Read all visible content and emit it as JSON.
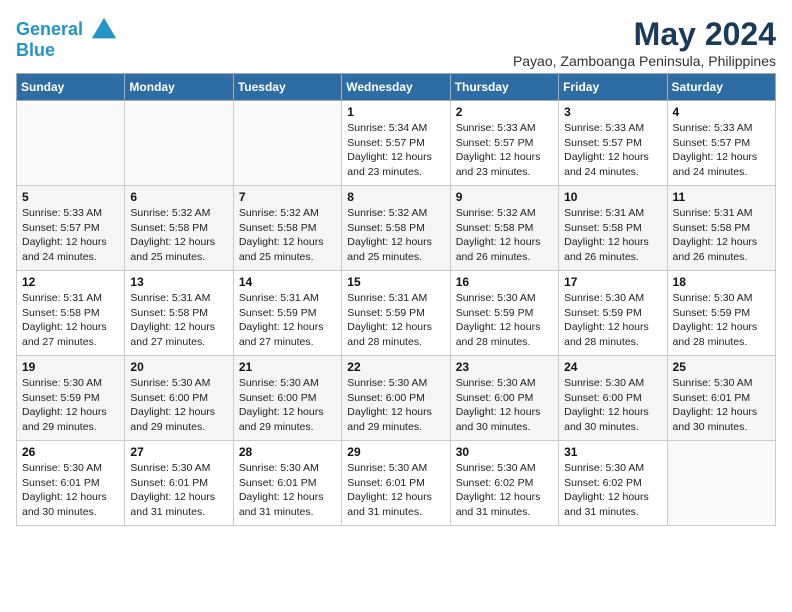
{
  "header": {
    "logo_line1": "General",
    "logo_line2": "Blue",
    "month": "May 2024",
    "location": "Payao, Zamboanga Peninsula, Philippines"
  },
  "weekdays": [
    "Sunday",
    "Monday",
    "Tuesday",
    "Wednesday",
    "Thursday",
    "Friday",
    "Saturday"
  ],
  "weeks": [
    [
      {
        "day": "",
        "info": ""
      },
      {
        "day": "",
        "info": ""
      },
      {
        "day": "",
        "info": ""
      },
      {
        "day": "1",
        "info": "Sunrise: 5:34 AM\nSunset: 5:57 PM\nDaylight: 12 hours\nand 23 minutes."
      },
      {
        "day": "2",
        "info": "Sunrise: 5:33 AM\nSunset: 5:57 PM\nDaylight: 12 hours\nand 23 minutes."
      },
      {
        "day": "3",
        "info": "Sunrise: 5:33 AM\nSunset: 5:57 PM\nDaylight: 12 hours\nand 24 minutes."
      },
      {
        "day": "4",
        "info": "Sunrise: 5:33 AM\nSunset: 5:57 PM\nDaylight: 12 hours\nand 24 minutes."
      }
    ],
    [
      {
        "day": "5",
        "info": "Sunrise: 5:33 AM\nSunset: 5:57 PM\nDaylight: 12 hours\nand 24 minutes."
      },
      {
        "day": "6",
        "info": "Sunrise: 5:32 AM\nSunset: 5:58 PM\nDaylight: 12 hours\nand 25 minutes."
      },
      {
        "day": "7",
        "info": "Sunrise: 5:32 AM\nSunset: 5:58 PM\nDaylight: 12 hours\nand 25 minutes."
      },
      {
        "day": "8",
        "info": "Sunrise: 5:32 AM\nSunset: 5:58 PM\nDaylight: 12 hours\nand 25 minutes."
      },
      {
        "day": "9",
        "info": "Sunrise: 5:32 AM\nSunset: 5:58 PM\nDaylight: 12 hours\nand 26 minutes."
      },
      {
        "day": "10",
        "info": "Sunrise: 5:31 AM\nSunset: 5:58 PM\nDaylight: 12 hours\nand 26 minutes."
      },
      {
        "day": "11",
        "info": "Sunrise: 5:31 AM\nSunset: 5:58 PM\nDaylight: 12 hours\nand 26 minutes."
      }
    ],
    [
      {
        "day": "12",
        "info": "Sunrise: 5:31 AM\nSunset: 5:58 PM\nDaylight: 12 hours\nand 27 minutes."
      },
      {
        "day": "13",
        "info": "Sunrise: 5:31 AM\nSunset: 5:58 PM\nDaylight: 12 hours\nand 27 minutes."
      },
      {
        "day": "14",
        "info": "Sunrise: 5:31 AM\nSunset: 5:59 PM\nDaylight: 12 hours\nand 27 minutes."
      },
      {
        "day": "15",
        "info": "Sunrise: 5:31 AM\nSunset: 5:59 PM\nDaylight: 12 hours\nand 28 minutes."
      },
      {
        "day": "16",
        "info": "Sunrise: 5:30 AM\nSunset: 5:59 PM\nDaylight: 12 hours\nand 28 minutes."
      },
      {
        "day": "17",
        "info": "Sunrise: 5:30 AM\nSunset: 5:59 PM\nDaylight: 12 hours\nand 28 minutes."
      },
      {
        "day": "18",
        "info": "Sunrise: 5:30 AM\nSunset: 5:59 PM\nDaylight: 12 hours\nand 28 minutes."
      }
    ],
    [
      {
        "day": "19",
        "info": "Sunrise: 5:30 AM\nSunset: 5:59 PM\nDaylight: 12 hours\nand 29 minutes."
      },
      {
        "day": "20",
        "info": "Sunrise: 5:30 AM\nSunset: 6:00 PM\nDaylight: 12 hours\nand 29 minutes."
      },
      {
        "day": "21",
        "info": "Sunrise: 5:30 AM\nSunset: 6:00 PM\nDaylight: 12 hours\nand 29 minutes."
      },
      {
        "day": "22",
        "info": "Sunrise: 5:30 AM\nSunset: 6:00 PM\nDaylight: 12 hours\nand 29 minutes."
      },
      {
        "day": "23",
        "info": "Sunrise: 5:30 AM\nSunset: 6:00 PM\nDaylight: 12 hours\nand 30 minutes."
      },
      {
        "day": "24",
        "info": "Sunrise: 5:30 AM\nSunset: 6:00 PM\nDaylight: 12 hours\nand 30 minutes."
      },
      {
        "day": "25",
        "info": "Sunrise: 5:30 AM\nSunset: 6:01 PM\nDaylight: 12 hours\nand 30 minutes."
      }
    ],
    [
      {
        "day": "26",
        "info": "Sunrise: 5:30 AM\nSunset: 6:01 PM\nDaylight: 12 hours\nand 30 minutes."
      },
      {
        "day": "27",
        "info": "Sunrise: 5:30 AM\nSunset: 6:01 PM\nDaylight: 12 hours\nand 31 minutes."
      },
      {
        "day": "28",
        "info": "Sunrise: 5:30 AM\nSunset: 6:01 PM\nDaylight: 12 hours\nand 31 minutes."
      },
      {
        "day": "29",
        "info": "Sunrise: 5:30 AM\nSunset: 6:01 PM\nDaylight: 12 hours\nand 31 minutes."
      },
      {
        "day": "30",
        "info": "Sunrise: 5:30 AM\nSunset: 6:02 PM\nDaylight: 12 hours\nand 31 minutes."
      },
      {
        "day": "31",
        "info": "Sunrise: 5:30 AM\nSunset: 6:02 PM\nDaylight: 12 hours\nand 31 minutes."
      },
      {
        "day": "",
        "info": ""
      }
    ]
  ]
}
